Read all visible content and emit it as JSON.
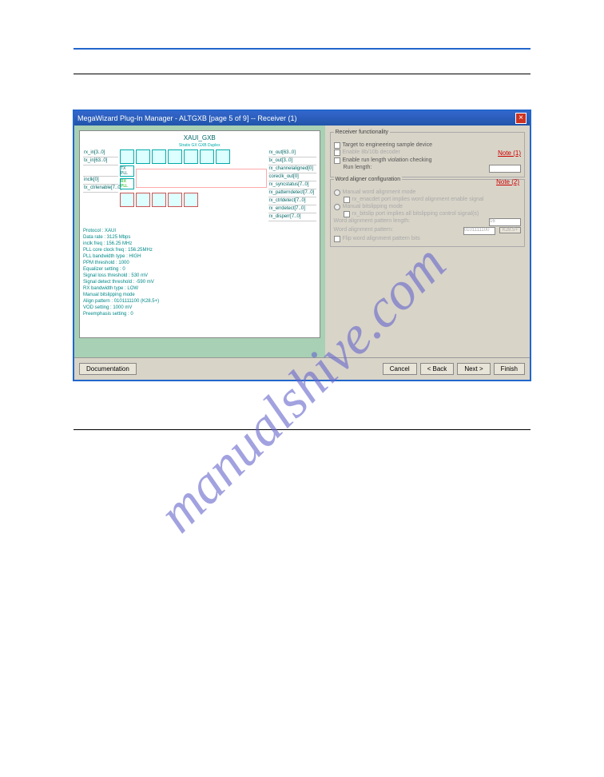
{
  "watermark": "manualshive.com",
  "wizard": {
    "title": "MegaWizard Plug-In Manager - ALTGXB [page 5 of 9] -- Receiver (1)",
    "close": "×",
    "diagram": {
      "title": "XAUI_GXB",
      "subtitle": "Stratix GX\nGXB Duplex",
      "left_ports": [
        "rx_in[3..0]",
        "tx_in[63..0]",
        "",
        "inclk[0]",
        "tx_ctrlenable[7..0]"
      ],
      "right_ports": [
        "rx_out[63..0]",
        "tx_out[3..0]",
        "rx_channelaligned[0]",
        "coreclk_out[0]",
        "rx_syncstatus[7..0]",
        "rx_patterndetect[7..0]",
        "rx_ctrldetect[7..0]",
        "rx_errdetect[7..0]",
        "rx_disperr[7..0]"
      ],
      "pll_labels": [
        "TX\nPLL",
        "RX\nPLL"
      ],
      "stats": [
        "Protocol : XAUI",
        "Data rate : 3125 Mbps",
        "inclk freq : 156.25 MHz",
        "PLL core clock freq : 156.25MHz",
        "PLL bandwidth type : HIGH",
        "PPM threshold : 1000",
        "Equalizer setting : 0",
        "Signal loss threshold : 530 mV",
        "Signal detect threshold : -590 mV",
        "RX bandwidth type : LOW",
        "Manual bitslipping mode",
        "Align pattern : 0101111100 (K28.5+)",
        "VOD setting : 1000 mV",
        "Preemphasis setting : 0"
      ]
    },
    "receiver": {
      "legend": "Receiver functionality",
      "target_device": "Target to engineering sample device",
      "enable_8b10b": "Enable 8b/10b decoder",
      "note1": "Note (1)",
      "enable_runlength": "Enable run length violation checking",
      "runlength_label": "Run length:",
      "runlength_value": ""
    },
    "aligner": {
      "legend": "Word aligner configuration",
      "note2": "Note (2)",
      "manual_mode": "Manual word alignment mode",
      "rx_enacdet": "rx_enacdet port implies word alignment enable signal",
      "manual_bitslip": "Manual bitslipping mode",
      "rx_bitslip": "rx_bitslip port implies all bitslipping control signal(s)",
      "pattern_length_label": "Word alignment pattern length:",
      "pattern_length_value": "16",
      "pattern_label": "Word alignment pattern:",
      "pattern_value": "0101111100",
      "k285_btn": "K28.5+",
      "flip_pattern": "Flip word alignment pattern bits"
    },
    "buttons": {
      "doc": "Documentation",
      "cancel": "Cancel",
      "back": "< Back",
      "next": "Next >",
      "finish": "Finish"
    }
  }
}
